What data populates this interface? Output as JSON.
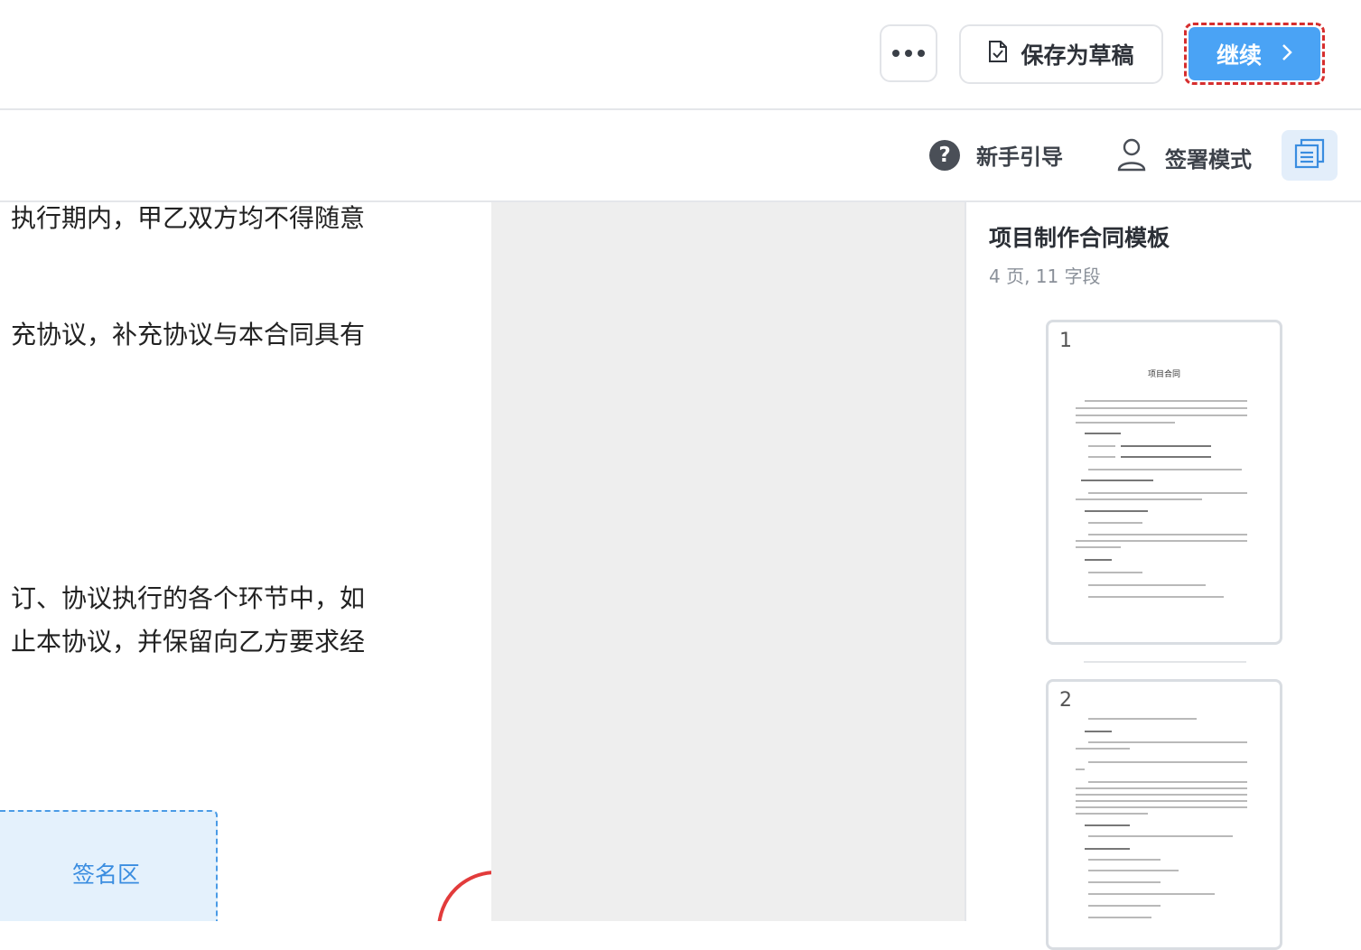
{
  "topbar": {
    "more_label": "•••",
    "save_draft_label": "保存为草稿",
    "continue_label": "继续"
  },
  "toolbar": {
    "guide_label": "新手引导",
    "sign_mode_label": "签署模式"
  },
  "document": {
    "lines": [
      "执行期内，甲乙双方均不得随意",
      "充协议，补充协议与本合同具有",
      "订、协议执行的各个环节中，如",
      "止本协议，并保留向乙方要求经"
    ],
    "signature_zone_label": "签名区"
  },
  "side_panel": {
    "title": "项目制作合同模板",
    "meta": "4 页, 11 字段",
    "pages": [
      {
        "number": "1",
        "heading": "项目合同"
      },
      {
        "number": "2",
        "heading": ""
      }
    ]
  }
}
